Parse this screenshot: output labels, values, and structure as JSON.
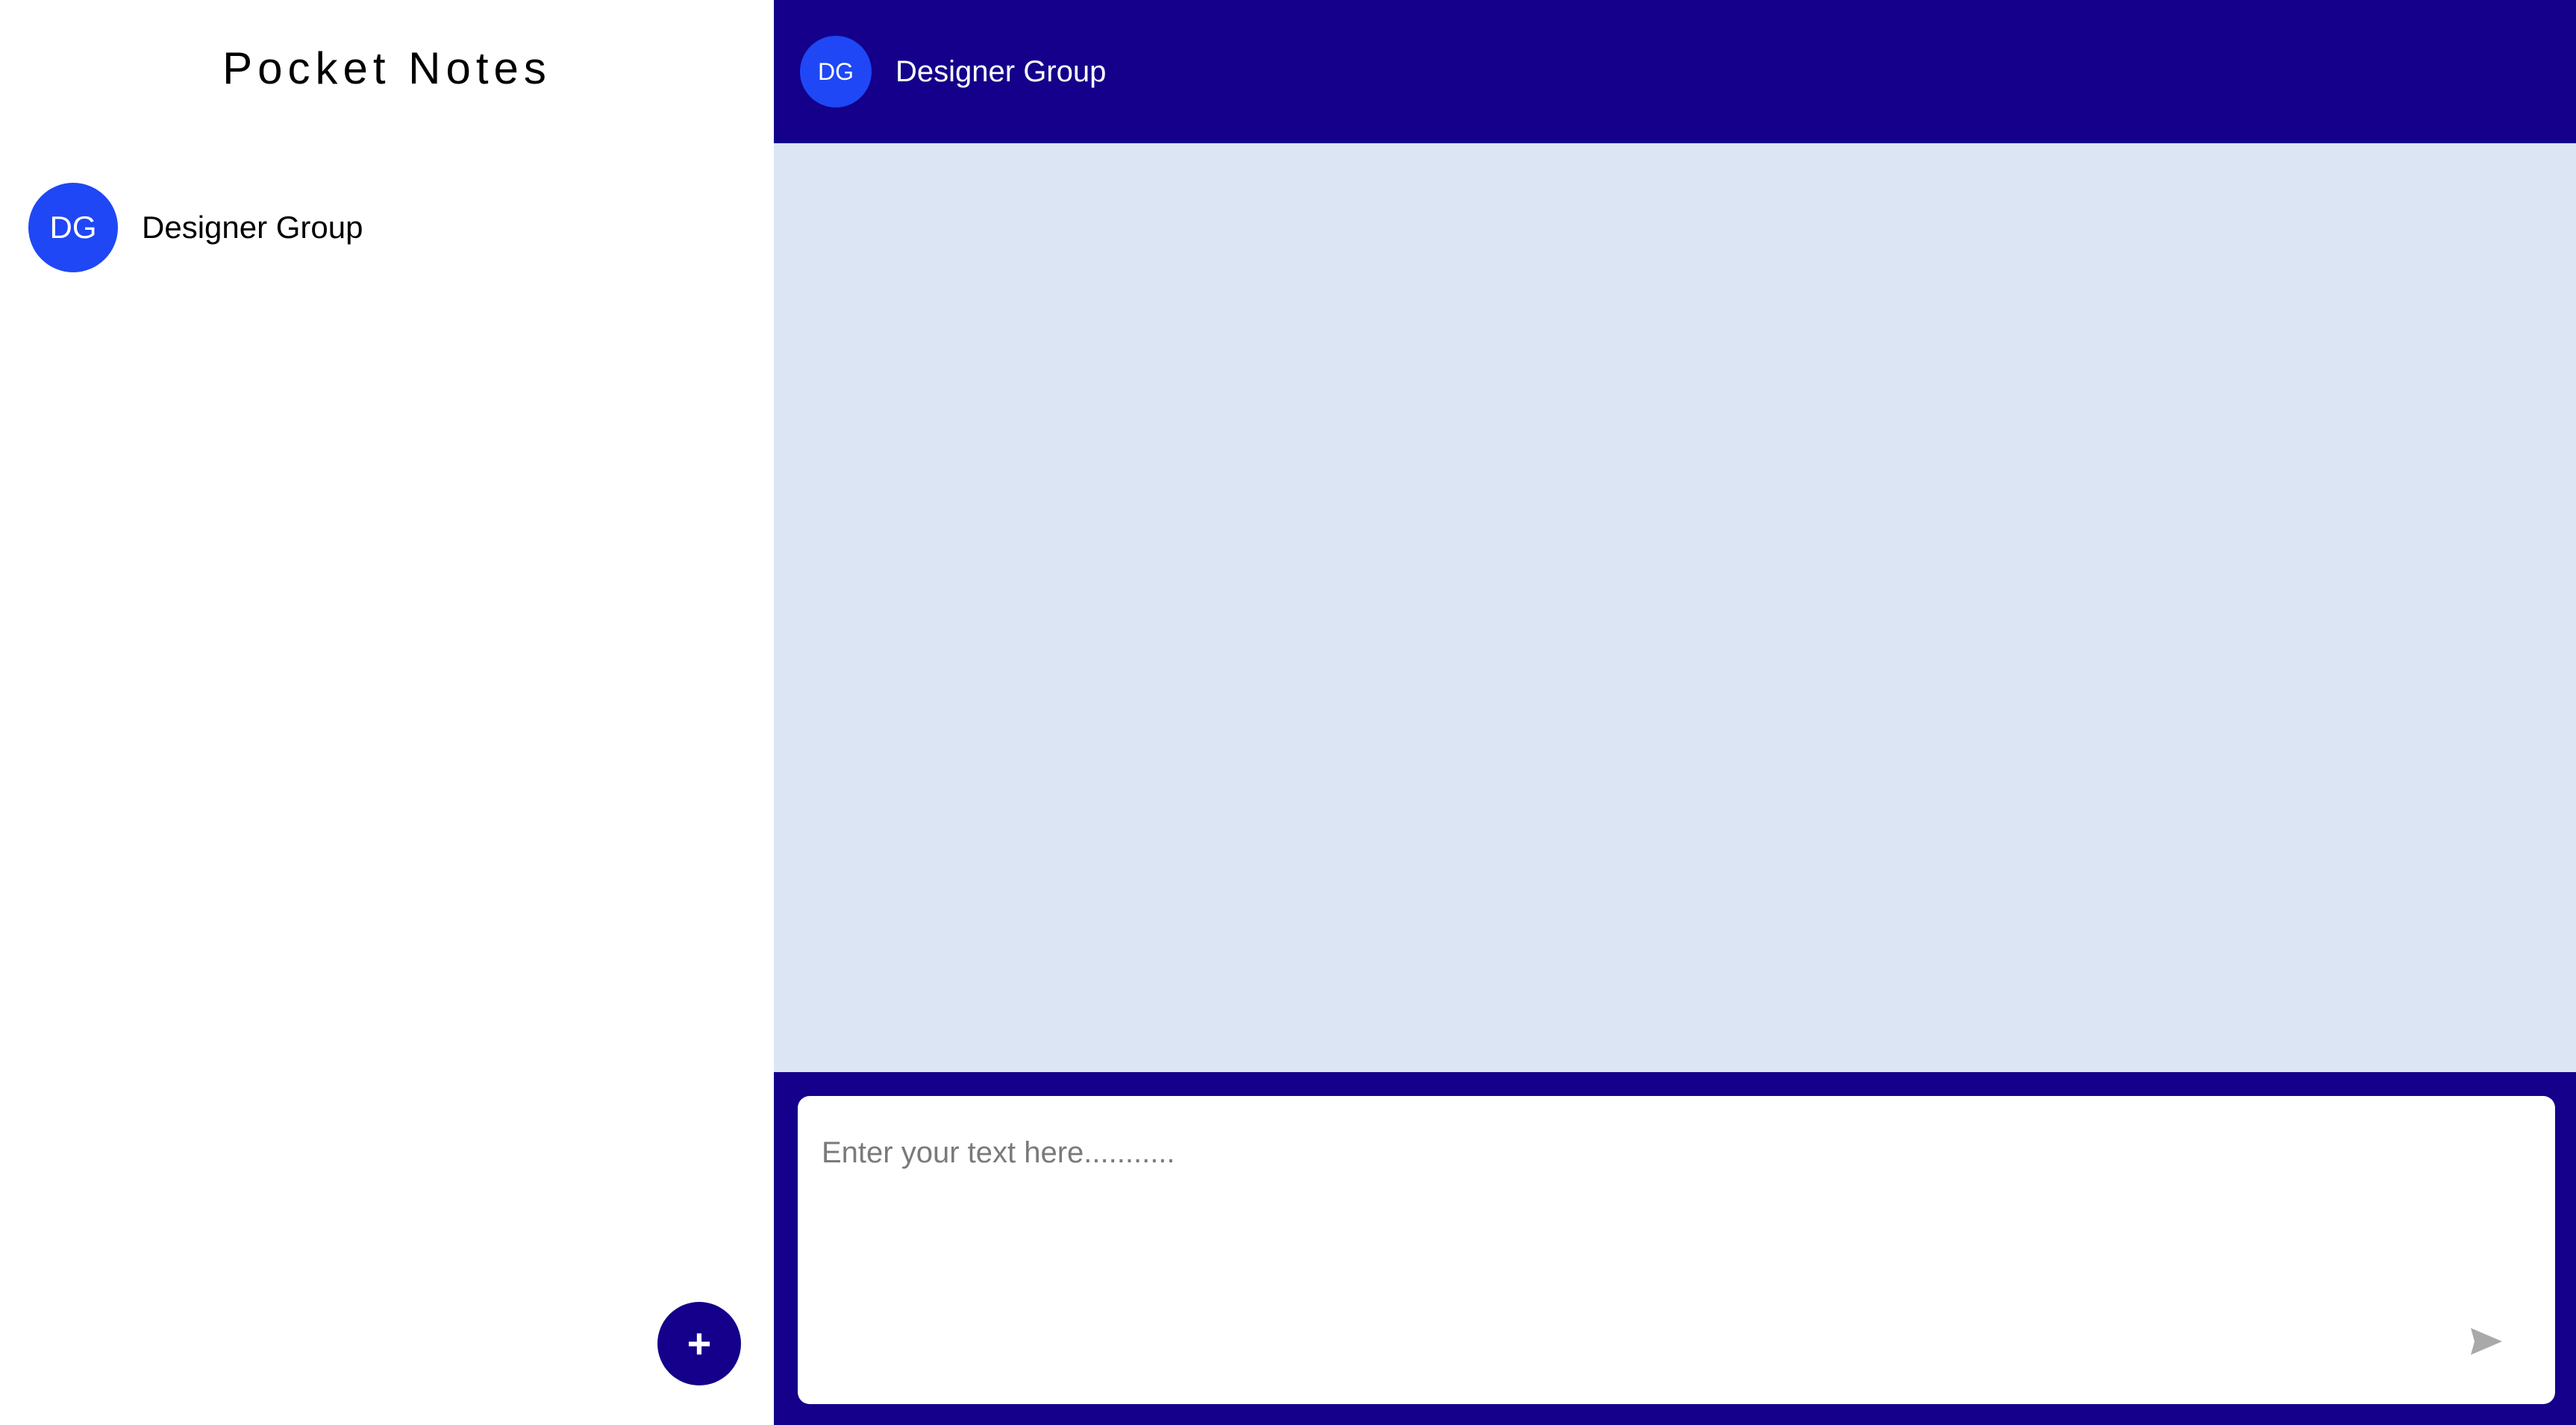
{
  "colors": {
    "accent_dark": "#14008a",
    "avatar_blue": "#1f47f5",
    "messages_bg": "#dce5f4",
    "send_icon": "#a9a9a9"
  },
  "sidebar": {
    "title": "Pocket Notes",
    "groups": [
      {
        "initials": "DG",
        "name": "Designer Group"
      }
    ],
    "add_button_label": "+"
  },
  "chat": {
    "header": {
      "initials": "DG",
      "name": "Designer Group"
    },
    "composer": {
      "placeholder": "Enter your text here...........",
      "value": "",
      "send_icon": "send-arrow-icon"
    }
  }
}
